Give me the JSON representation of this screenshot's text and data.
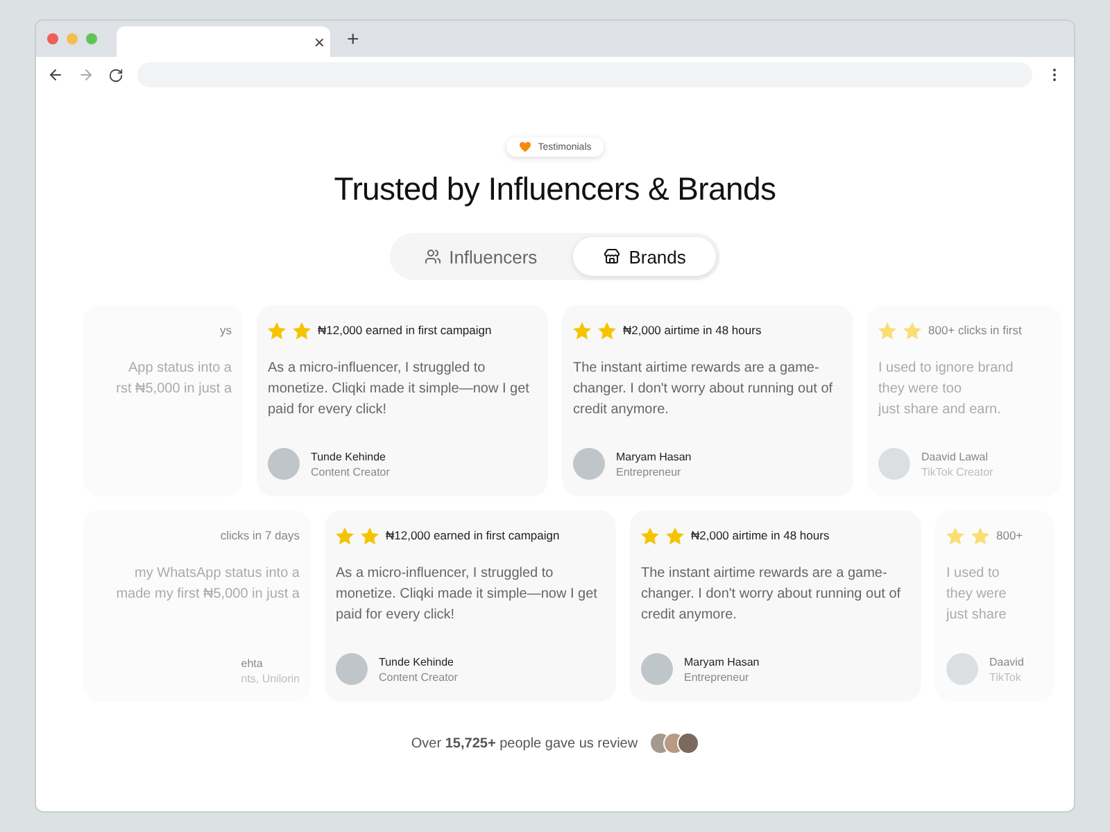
{
  "browser": {
    "tab_close": "×",
    "new_tab": "+"
  },
  "badge": {
    "label": "Testimonials"
  },
  "title": "Trusted by Influencers & Brands",
  "tabs": [
    {
      "label": "Influencers",
      "selected": false
    },
    {
      "label": "Brands",
      "selected": true
    }
  ],
  "rows": [
    {
      "cards": [
        {
          "kind": "partial-left",
          "headline": "ys",
          "lines": [
            "App status into a",
            "rst ₦5,000 in just a"
          ]
        },
        {
          "kind": "full",
          "headline": "₦12,000 earned in first campaign",
          "lines": [
            "As a micro-influencer, I struggled to",
            "monetize. Cliqki made it simple—now I get",
            "paid for every click!"
          ],
          "name": "Tunde Kehinde",
          "role": "Content Creator"
        },
        {
          "kind": "full",
          "headline": "₦2,000 airtime in 48 hours",
          "lines": [
            "The instant airtime rewards are a game-",
            "changer. I don't worry about running out of",
            "credit anymore."
          ],
          "name": "Maryam Hasan",
          "role": "Entrepreneur"
        },
        {
          "kind": "partial-right",
          "headline": "800+ clicks in first",
          "lines": [
            "I used to ignore brand",
            "they were too",
            "just share and earn."
          ],
          "name": "Daavid Lawal",
          "role": "TikTok Creator"
        }
      ]
    },
    {
      "cards": [
        {
          "kind": "partial-left",
          "headline": "clicks in 7 days",
          "lines": [
            "my WhatsApp status into a",
            "made my first ₦5,000 in just a"
          ],
          "name": "ehta",
          "role": "nts, Unilorin"
        },
        {
          "kind": "full",
          "headline": "₦12,000 earned in first campaign",
          "lines": [
            "As a micro-influencer, I struggled to",
            "monetize. Cliqki made it simple—now I get",
            "paid for every click!"
          ],
          "name": "Tunde Kehinde",
          "role": "Content Creator"
        },
        {
          "kind": "full",
          "headline": "₦2,000 airtime in 48 hours",
          "lines": [
            "The instant airtime rewards are a game-",
            "changer. I don't worry about running out of",
            "credit anymore."
          ],
          "name": "Maryam Hasan",
          "role": "Entrepreneur"
        },
        {
          "kind": "partial-right",
          "headline": "800+",
          "lines": [
            "I used to",
            "they were",
            "just share"
          ],
          "name": "Daavid",
          "role": "TikTok"
        }
      ]
    }
  ],
  "footer": {
    "text": "Over **15,725+** people gave us review"
  }
}
